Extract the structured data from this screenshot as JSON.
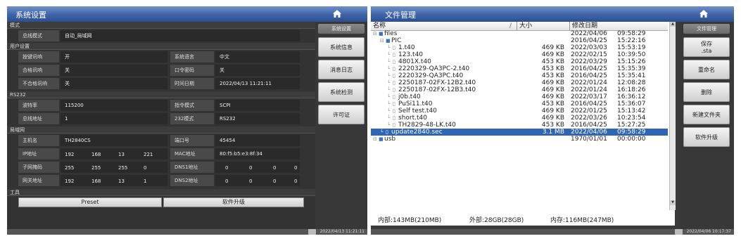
{
  "left": {
    "title": "系统设置",
    "side_header": "系统设置",
    "side_buttons": [
      "系统信息",
      "消息日志",
      "系统检测",
      "许可证"
    ],
    "status_date": "2022/04/13 11:21:11",
    "sections": {
      "mode": "模式",
      "user": "用户设置",
      "rs232": "RS232",
      "lan": "局域网",
      "tools": "工具"
    },
    "mode": {
      "label": "总线模式",
      "value": "自动_局域网"
    },
    "user": {
      "key_beep_label": "按键讯响",
      "key_beep_value": "开",
      "lang_label": "系统语言",
      "lang_value": "中文",
      "pass_beep_label": "合格讯响",
      "pass_beep_value": "关",
      "password_label": "口令密码",
      "password_value": "关",
      "fail_beep_label": "不合格讯响",
      "fail_beep_value": "关",
      "datetime_label": "时间日期",
      "datetime_value": "2022/04/13 11:21:11"
    },
    "rs232": {
      "baud_label": "波特率",
      "baud_value": "115200",
      "cmd_label": "指令模式",
      "cmd_value": "SCPI",
      "addr_label": "总线地址",
      "addr_value": "1",
      "mode232_label": "232模式",
      "mode232_value": "RS232"
    },
    "lan": {
      "host_label": "主机名",
      "host_value": "TH2840CS",
      "port_label": "端口号",
      "port_value": "45454",
      "ip_label": "IP地址",
      "ip": [
        "192",
        "168",
        "13",
        "221"
      ],
      "mac_label": "MAC地址",
      "mac_value": "80:f5:b5:e3:8f:34",
      "mask_label": "子网掩码",
      "mask": [
        "255",
        "255",
        "255",
        "0"
      ],
      "dns1_label": "DNS1地址",
      "dns1": [
        "0",
        "0",
        "0",
        "0"
      ],
      "gw_label": "网关地址",
      "gw": [
        "192",
        "168",
        "13",
        "1"
      ],
      "dns2_label": "DNS2地址",
      "dns2": [
        "0",
        "0",
        "0",
        "0"
      ]
    },
    "tools": {
      "preset": "Preset",
      "upgrade": "软件升级"
    }
  },
  "right": {
    "title": "文件管理",
    "side_header": "文件管理",
    "side_buttons": [
      "保存\n.sta",
      "重命名",
      "删除",
      "新建文件夹",
      "软件升级"
    ],
    "status_date": "2022/04/06 10:17:37",
    "columns": {
      "name": "名称",
      "size": "大小",
      "date": "修改日期"
    },
    "rows": [
      {
        "name": "files",
        "size": "",
        "date": "2022/04/06",
        "time": "09:58:29",
        "level": 0,
        "type": "folder"
      },
      {
        "name": "PIC",
        "size": "",
        "date": "2016/04/25",
        "time": "15:22:16",
        "level": 1,
        "type": "folder"
      },
      {
        "name": "1.t40",
        "size": "469 KB",
        "date": "2022/03/03",
        "time": "15:53:19",
        "level": 2,
        "type": "file"
      },
      {
        "name": "123.t40",
        "size": "469 KB",
        "date": "2022/02/15",
        "time": "10:39:50",
        "level": 2,
        "type": "file"
      },
      {
        "name": "4801X.t40",
        "size": "453 KB",
        "date": "2022/03/29",
        "time": "15:15:26",
        "level": 2,
        "type": "file"
      },
      {
        "name": "2220329-QA3PC-2.t40",
        "size": "453 KB",
        "date": "2016/04/25",
        "time": "15:35:39",
        "level": 2,
        "type": "file"
      },
      {
        "name": "2220329-QA3PC.t40",
        "size": "453 KB",
        "date": "2016/04/25",
        "time": "15:35:41",
        "level": 2,
        "type": "file"
      },
      {
        "name": "2250187-02FX-12B2.t40",
        "size": "469 KB",
        "date": "2022/01/24",
        "time": "12:08:28",
        "level": 2,
        "type": "file"
      },
      {
        "name": "2250187-02FX-12B3.t40",
        "size": "469 KB",
        "date": "2022/01/24",
        "time": "16:18:26",
        "level": 2,
        "type": "file"
      },
      {
        "name": "j0b.t40",
        "size": "469 KB",
        "date": "2022/03/17",
        "time": "16:36:12",
        "level": 2,
        "type": "file"
      },
      {
        "name": "PuSi11.t40",
        "size": "453 KB",
        "date": "2016/04/25",
        "time": "15:36:07",
        "level": 2,
        "type": "file"
      },
      {
        "name": "Self test.t40",
        "size": "469 KB",
        "date": "2022/01/25",
        "time": "15:13:42",
        "level": 2,
        "type": "file"
      },
      {
        "name": "short.t40",
        "size": "469 KB",
        "date": "2022/03/26",
        "time": "10:23:54",
        "level": 2,
        "type": "file"
      },
      {
        "name": "TH2829-48-LK.t40",
        "size": "453 KB",
        "date": "2016/04/25",
        "time": "15:27:25",
        "level": 2,
        "type": "file"
      },
      {
        "name": "update2840.sec",
        "size": "3.1 MB",
        "date": "2022/04/06",
        "time": "09:58:29",
        "level": 1,
        "type": "file",
        "selected": true
      },
      {
        "name": "usb",
        "size": "",
        "date": "1970/01/01",
        "time": "00:00:00",
        "level": 0,
        "type": "folder"
      }
    ],
    "memory": {
      "internal": "内部:143MB(210MB)",
      "external": "外部:28GB(28GB)",
      "ram": "内存:116MB(247MB)"
    }
  }
}
